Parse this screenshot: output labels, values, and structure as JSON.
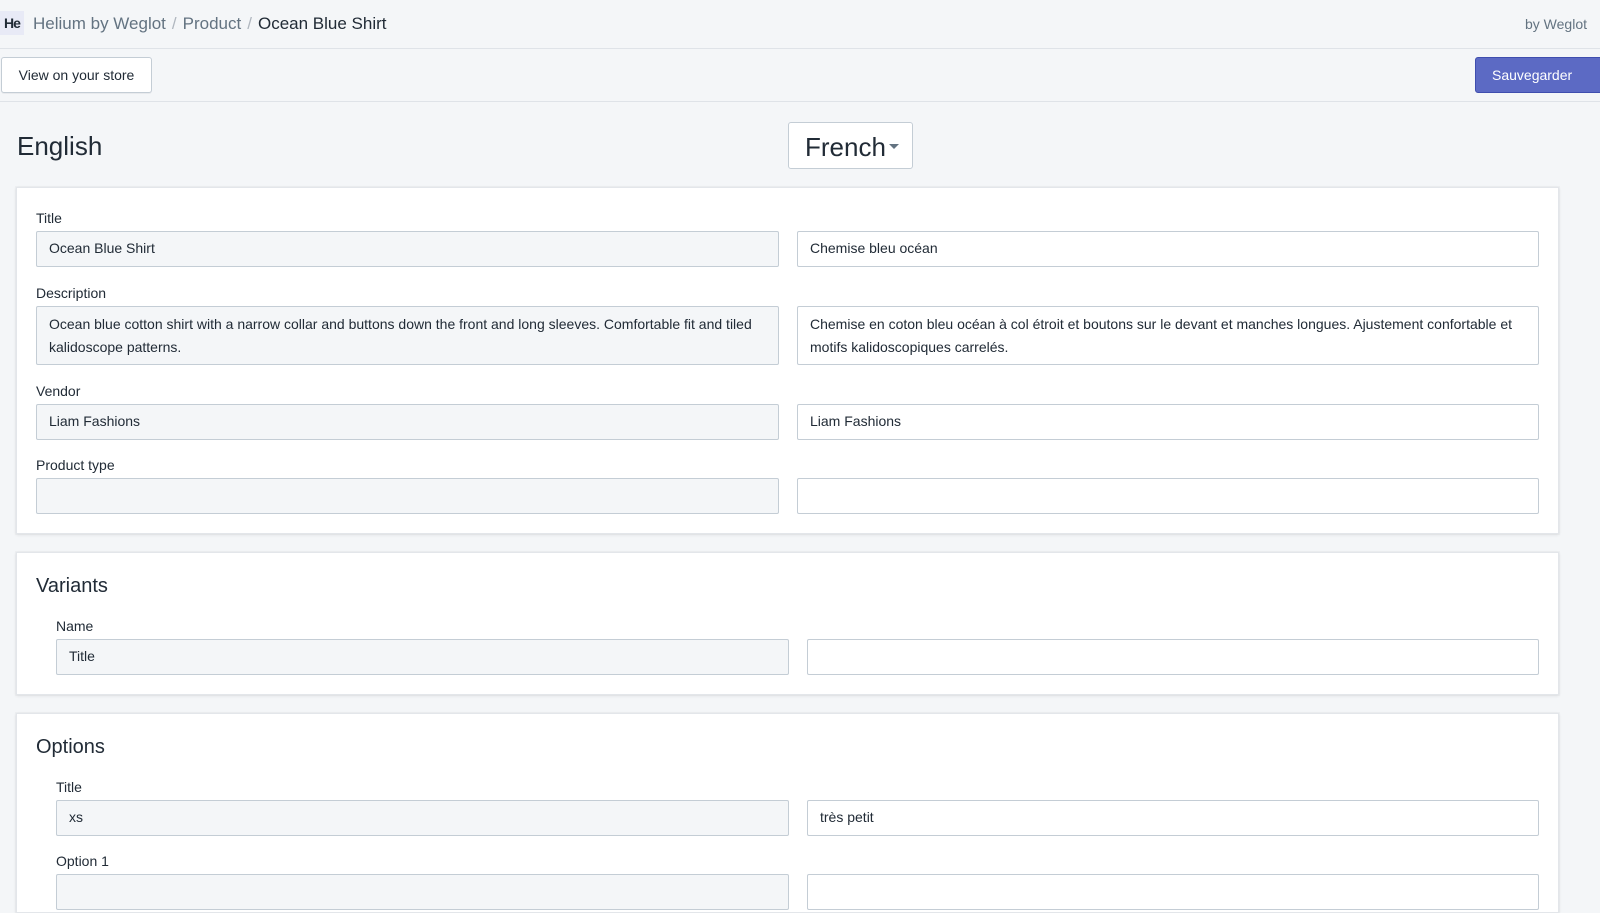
{
  "header": {
    "logo_text": "He",
    "breadcrumb": [
      "Helium by Weglot",
      "Product",
      "Ocean Blue Shirt"
    ],
    "byline": "by Weglot"
  },
  "toolbar": {
    "view_label": "View on your store",
    "save_label": "Sauvegarder"
  },
  "languages": {
    "source": "English",
    "target": "French"
  },
  "product": {
    "fields": [
      {
        "label": "Title",
        "source": "Ocean Blue Shirt",
        "target": "Chemise bleu océan"
      },
      {
        "label": "Description",
        "source": "Ocean blue cotton shirt with a narrow collar and buttons down the front and long sleeves. Comfortable fit and tiled kalidoscope patterns.",
        "target": "Chemise en coton bleu océan à col étroit et boutons sur le devant et manches longues. Ajustement confortable et motifs kalidoscopiques carrelés."
      },
      {
        "label": "Vendor",
        "source": "Liam Fashions",
        "target": "Liam Fashions"
      },
      {
        "label": "Product type",
        "source": "",
        "target": ""
      }
    ]
  },
  "variants": {
    "title": "Variants",
    "name_label": "Name",
    "name_source": "Title",
    "name_target": ""
  },
  "options": {
    "title": "Options",
    "title_label": "Title",
    "title_source": "xs",
    "title_target": "très petit",
    "option1_label": "Option 1"
  }
}
